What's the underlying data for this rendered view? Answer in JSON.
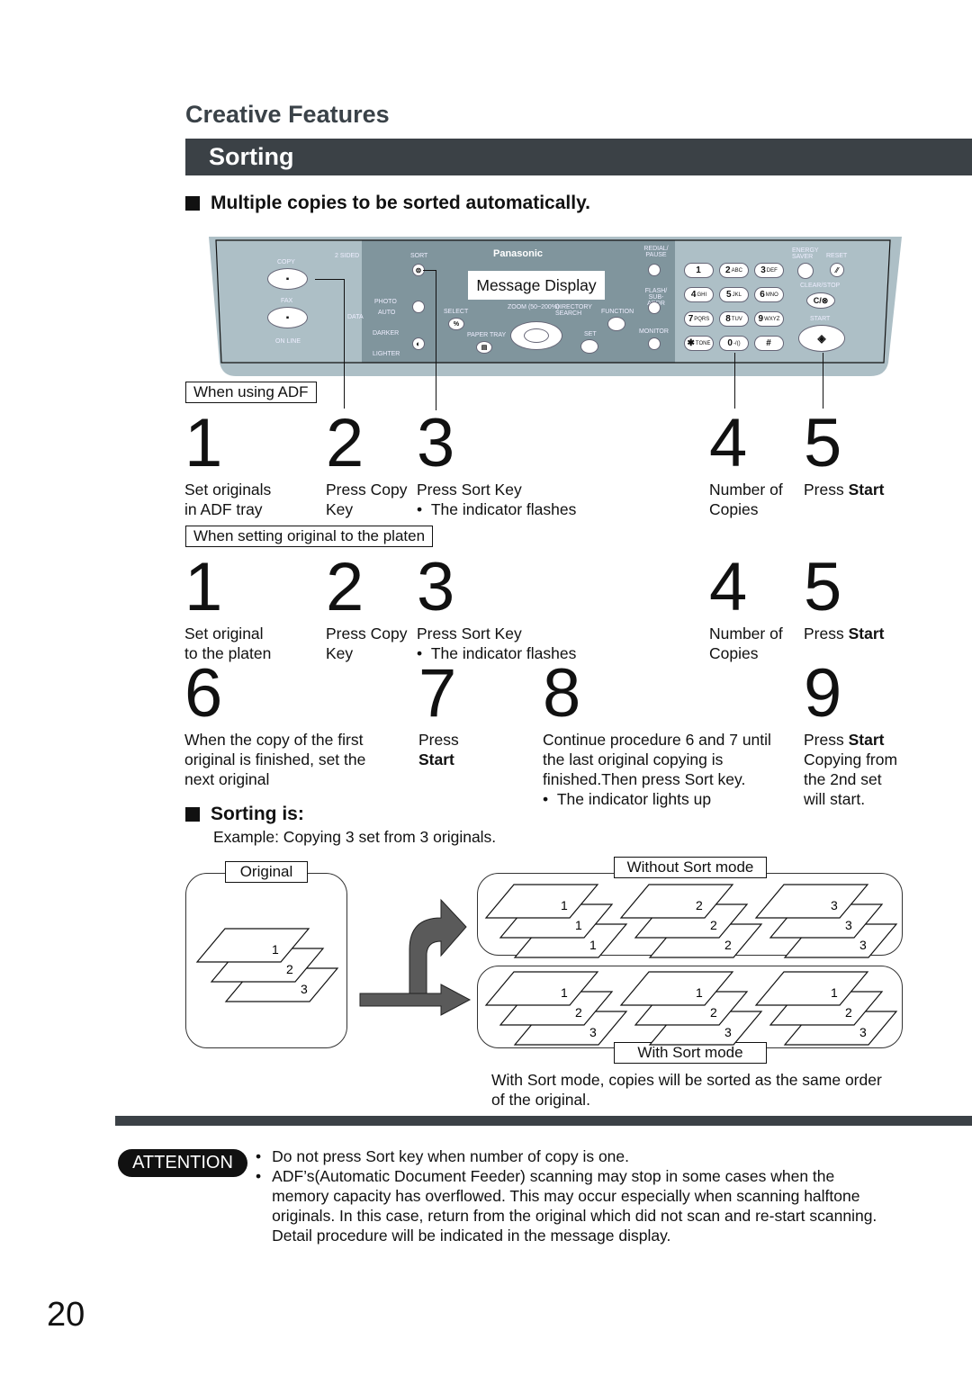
{
  "section_title": "Creative Features",
  "page_title": "Sorting",
  "heading1": "Multiple copies to be sorted automatically.",
  "panel": {
    "brand": "Panasonic",
    "message_display": "Message Display",
    "labels": {
      "copy": "COPY",
      "fax": "FAX",
      "online": "ON LINE",
      "two_sided": "2 SIDED",
      "sort": "SORT",
      "photo": "PHOTO",
      "auto": "AUTO",
      "darker": "DARKER",
      "lighter": "LIGHTER",
      "select": "SELECT",
      "zoom": "ZOOM (50~200%)",
      "directory": "DIRECTORY SEARCH",
      "function": "FUNCTION",
      "paper_tray": "PAPER TRAY",
      "set": "SET",
      "redial": "REDIAL/ PAUSE",
      "flash": "FLASH/ SUB-ADDR",
      "monitor": "MONITOR",
      "energy": "ENERGY SAVER",
      "reset": "RESET",
      "clear": "CLEAR/STOP",
      "start": "START",
      "data": "DATA"
    },
    "keypad": [
      [
        "1",
        ""
      ],
      [
        "2",
        "ABC"
      ],
      [
        "3",
        "DEF"
      ],
      [
        "4",
        "GHI"
      ],
      [
        "5",
        "JKL"
      ],
      [
        "6",
        "MNO"
      ],
      [
        "7",
        "PQRS"
      ],
      [
        "8",
        "TUV"
      ],
      [
        "9",
        "WXYZ"
      ],
      [
        "✱",
        "TONE"
      ],
      [
        "0",
        "-/()"
      ],
      [
        "#",
        ""
      ]
    ],
    "clear_key": "C/⊗",
    "select_key": "%"
  },
  "adf": {
    "label": "When using ADF",
    "steps": [
      {
        "n": "1",
        "lines": [
          "Set originals",
          "in ADF tray"
        ]
      },
      {
        "n": "2",
        "lines": [
          "Press Copy",
          "Key"
        ]
      },
      {
        "n": "3",
        "lines": [
          "Press Sort Key"
        ],
        "bullet": "The indicator flashes"
      },
      {
        "n": "4",
        "lines": [
          "Number of",
          "Copies"
        ]
      },
      {
        "n": "5",
        "pre": "Press ",
        "bold": "Start"
      }
    ]
  },
  "platen": {
    "label": "When setting original to the platen",
    "steps": [
      {
        "n": "1",
        "lines": [
          "Set original",
          "to the platen"
        ]
      },
      {
        "n": "2",
        "lines": [
          "Press Copy",
          "Key"
        ]
      },
      {
        "n": "3",
        "lines": [
          "Press Sort Key"
        ],
        "bullet": "The indicator flashes"
      },
      {
        "n": "4",
        "lines": [
          "Number of",
          "Copies"
        ]
      },
      {
        "n": "5",
        "pre": "Press ",
        "bold": "Start"
      },
      {
        "n": "6",
        "lines": [
          "When the copy of the first",
          "original is finished, set the",
          "next original"
        ]
      },
      {
        "n": "7",
        "lines": [
          "Press"
        ],
        "bold": "Start"
      },
      {
        "n": "8",
        "lines": [
          "Continue procedure 6 and 7 until",
          "the last original copying is",
          "finished.Then press Sort key."
        ],
        "bullet": "The indicator lights up"
      },
      {
        "n": "9",
        "pre": "Press ",
        "bold": "Start",
        "lines": [
          "Copying from",
          "the 2nd set",
          "will start."
        ]
      }
    ]
  },
  "sorting": {
    "heading": "Sorting is:",
    "example": "Example: Copying 3 set from 3 originals.",
    "original_label": "Original",
    "without_label": "Without Sort mode",
    "with_label": "With Sort mode",
    "original_stack": [
      "1",
      "2",
      "3"
    ],
    "without_stacks": [
      [
        "1",
        "1",
        "1"
      ],
      [
        "2",
        "2",
        "2"
      ],
      [
        "3",
        "3",
        "3"
      ]
    ],
    "with_stacks": [
      [
        "1",
        "2",
        "3"
      ],
      [
        "1",
        "2",
        "3"
      ],
      [
        "1",
        "2",
        "3"
      ]
    ],
    "note": [
      "With Sort mode, copies will be sorted as the same order",
      "of the original."
    ]
  },
  "attention": {
    "label": "ATTENTION",
    "items": [
      [
        "Do not press Sort key when number of copy is one."
      ],
      [
        "ADF’s(Automatic Document Feeder) scanning may stop in some cases when the",
        "memory capacity has overflowed. This may occur especially when scanning halftone",
        "originals. In this case, return from the original which did not scan and re-start scanning.",
        "Detail procedure will be indicated in the message display."
      ]
    ]
  },
  "page_number": "20",
  "colors": {
    "header_bar": "#3b4146",
    "panel_light": "#adbfc6",
    "panel_dark": "#80959d",
    "arrow": "#5a5a5a"
  }
}
